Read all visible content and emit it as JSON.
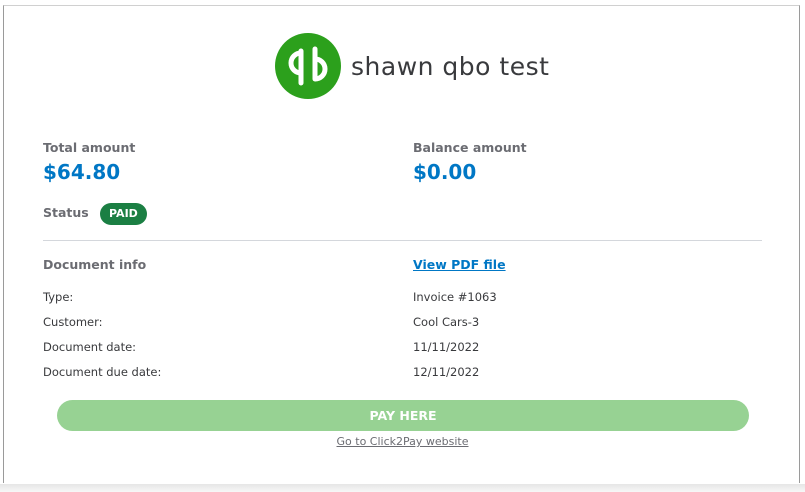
{
  "company": {
    "logo_icon": "quickbooks-qb-logo",
    "logo_color": "#2ca01c",
    "name": "shawn qbo test"
  },
  "summary": {
    "total_label": "Total amount",
    "total_value": "$64.80",
    "balance_label": "Balance amount",
    "balance_value": "$0.00",
    "status_label": "Status",
    "status_badge": "PAID"
  },
  "document": {
    "title": "Document info",
    "pdf_link": "View PDF file",
    "rows": [
      {
        "label": "Type:",
        "value": "Invoice #1063"
      },
      {
        "label": "Customer:",
        "value": "Cool Cars-3"
      },
      {
        "label": "Document date:",
        "value": "11/11/2022"
      },
      {
        "label": "Document due date:",
        "value": "12/11/2022"
      }
    ]
  },
  "actions": {
    "pay_button": "PAY HERE",
    "click2pay_link": "Go to Click2Pay website"
  },
  "colors": {
    "accent": "#0077c5",
    "paid_badge": "#1b7f43",
    "pay_button": "#97d293"
  }
}
